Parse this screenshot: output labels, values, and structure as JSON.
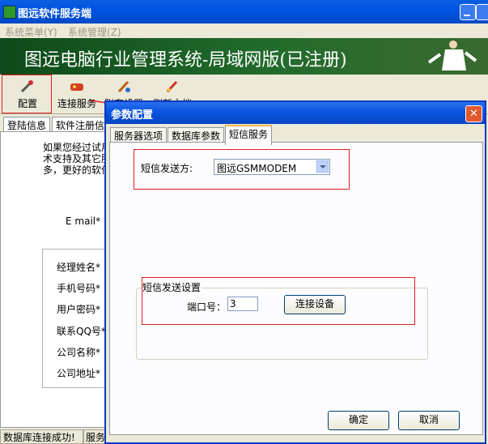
{
  "window": {
    "title": "图远软件服务端"
  },
  "menu": [
    "系统菜单(Y)",
    "系统管理(Z)"
  ],
  "banner": {
    "text": "图远电脑行业管理系统-局域网版(已注册)"
  },
  "toolbar": {
    "items": [
      "配置",
      "连接服务",
      "账套设置",
      "刷新文档"
    ]
  },
  "main_tabs": [
    "登陆信息",
    "软件注册信"
  ],
  "main_content": {
    "intro": [
      "如果您经过试用",
      "术支持及其它服",
      "多，更好的软件"
    ],
    "email_label": "E mail*",
    "fields": [
      "经理姓名*",
      "手机号码*",
      "用户密码*",
      "联系QQ号*",
      "公司名称*",
      "公司地址*"
    ]
  },
  "statusbar": [
    "数据库连接成功!",
    "服务"
  ],
  "dialog": {
    "title": "参数配置",
    "tabs": [
      "服务器选项",
      "数据库参数",
      "短信服务"
    ],
    "active_tab": "短信服务",
    "sms_sender_label": "短信发送方:",
    "sms_sender_value": "图远GSMMODEM",
    "sms_settings_group": "短信发送设置",
    "port_label": "端口号：",
    "port_value": "3",
    "connect_button": "连接设备",
    "ok_button": "确定",
    "cancel_button": "取消"
  },
  "colors": {
    "titlebar": "#0054e3",
    "highlight": "#e02020",
    "banner": "#1f6a2a"
  }
}
